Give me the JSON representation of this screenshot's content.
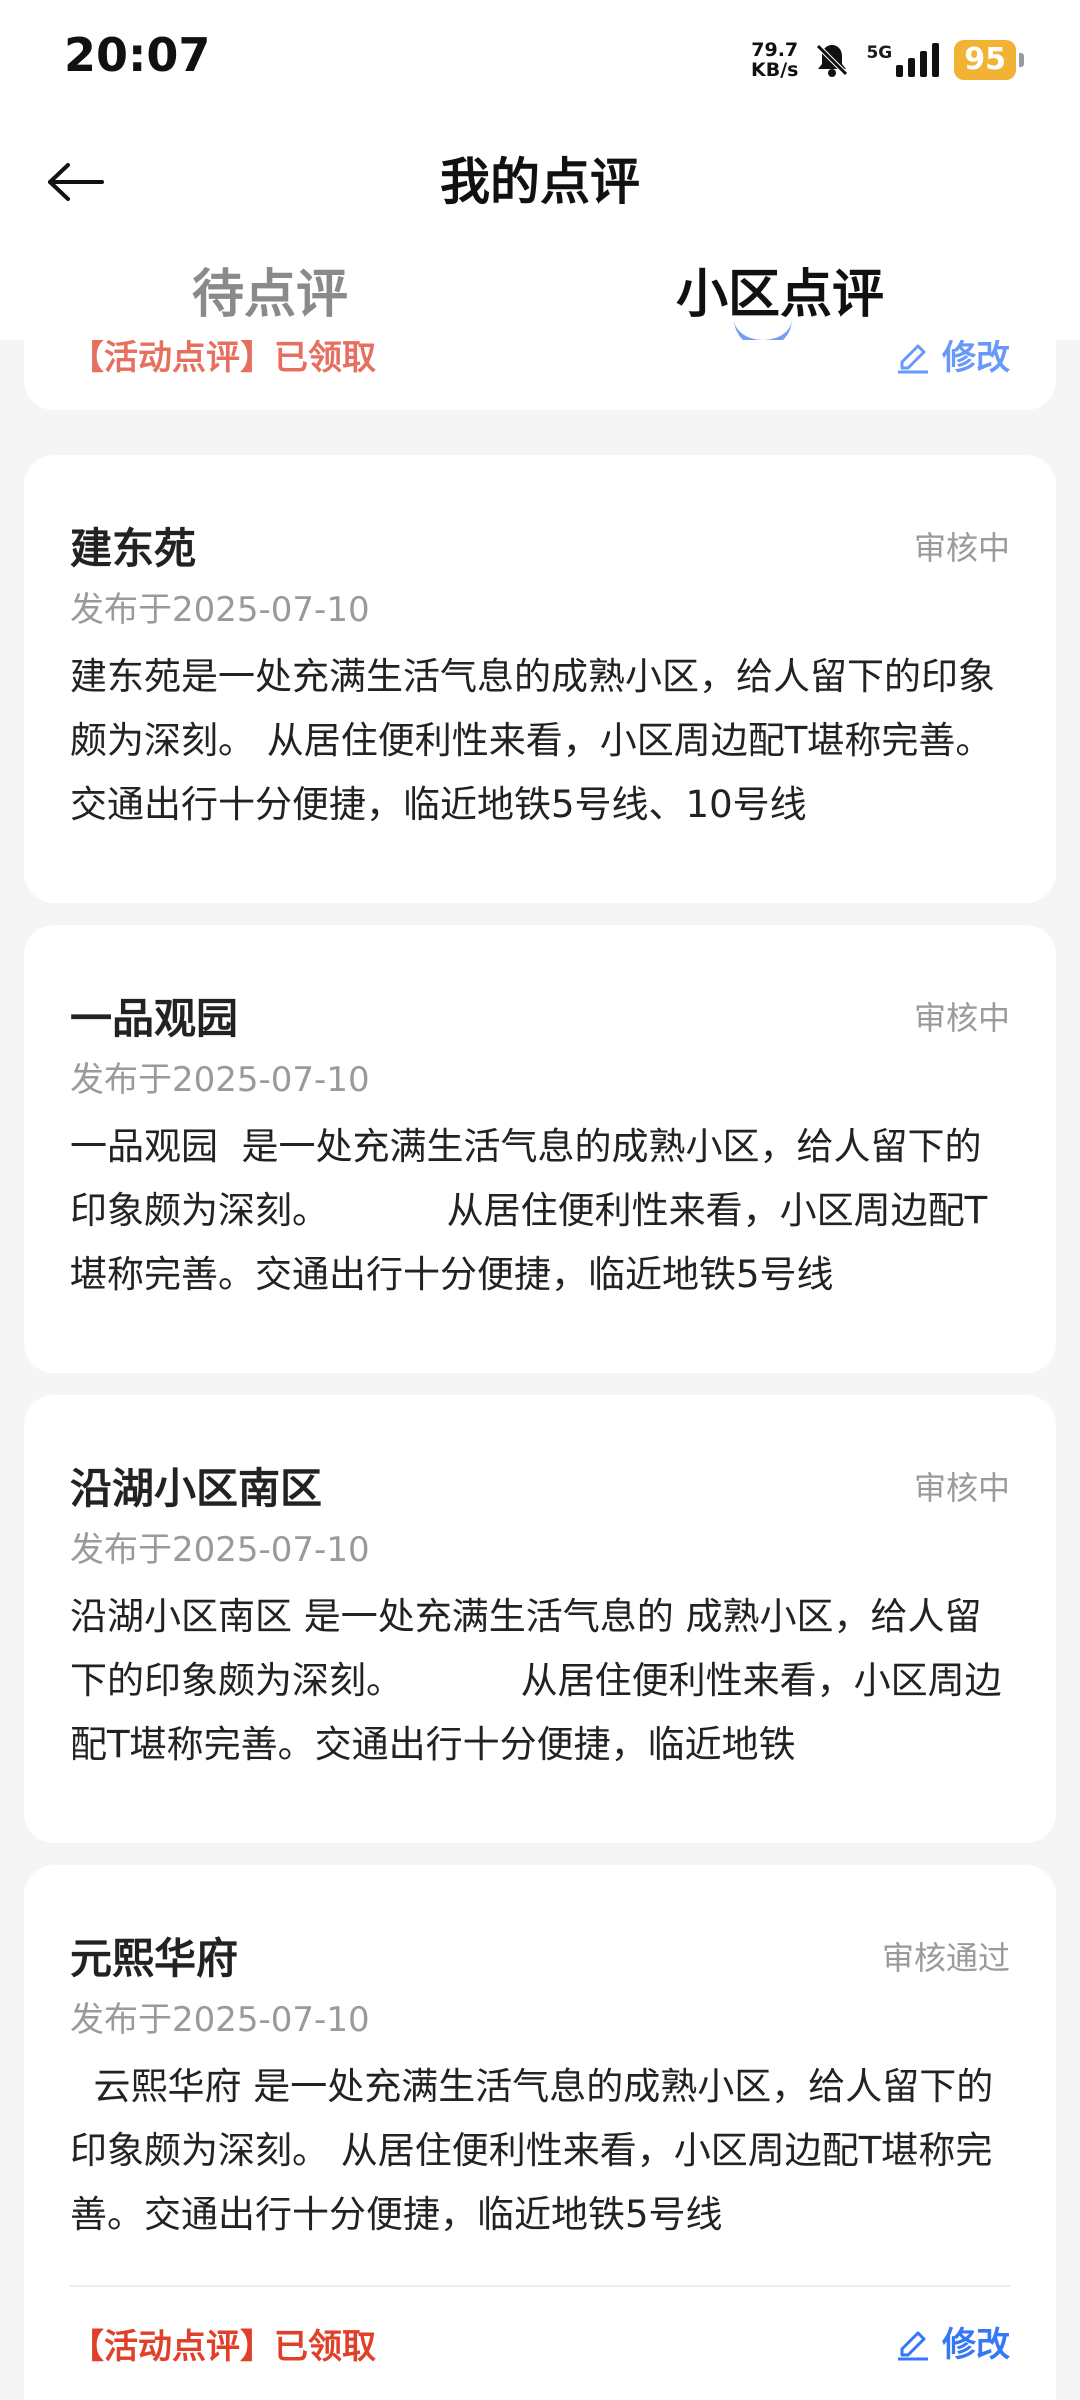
{
  "status_bar": {
    "time": "20:07",
    "net_speed_value": "79.7",
    "net_speed_unit": "KB/s",
    "network": "5G",
    "battery": "95"
  },
  "header": {
    "title": "我的点评",
    "tabs": [
      {
        "label": "待点评",
        "active": false
      },
      {
        "label": "小区点评",
        "active": true
      }
    ]
  },
  "partial_card": {
    "activity_tag": "【活动点评】已领取",
    "edit_label": "修改"
  },
  "reviews": [
    {
      "name": "建东苑",
      "status": "审核中",
      "date": "发布于2025-07-10",
      "text": "建东苑是一处充满生活气息的成熟小区，给人留下的印象颇为深刻。 从居住便利性来看，小区周边配T堪称完善。交通出行十分便捷，临近地铁5号线、10号线"
    },
    {
      "name": "一品观园",
      "status": "审核中",
      "date": "发布于2025-07-10",
      "text": "一品观园  是一处充满生活气息的成熟小区，给人留下的印象颇为深刻。          从居住便利性来看，小区周边配T堪称完善。交通出行十分便捷，临近地铁5号线"
    },
    {
      "name": "沿湖小区南区",
      "status": "审核中",
      "date": "发布于2025-07-10",
      "text": "沿湖小区南区 是一处充满生活气息的 成熟小区，给人留下的印象颇为深刻。          从居住便利性来看，小区周边配T堪称完善。交通出行十分便捷，临近地铁"
    },
    {
      "name": "元熙华府",
      "status": "审核通过",
      "date": "发布于2025-07-10",
      "text": "  云熙华府 是一处充满生活气息的成熟小区，给人留下的印象颇为深刻。 从居住便利性来看，小区周边配T堪称完善。交通出行十分便捷，临近地铁5号线",
      "activity_tag": "【活动点评】已领取",
      "edit_label": "修改"
    }
  ],
  "colors": {
    "accent_blue": "#3478f6",
    "activity_red": "#e0402a",
    "battery_yellow": "#f2b233"
  }
}
